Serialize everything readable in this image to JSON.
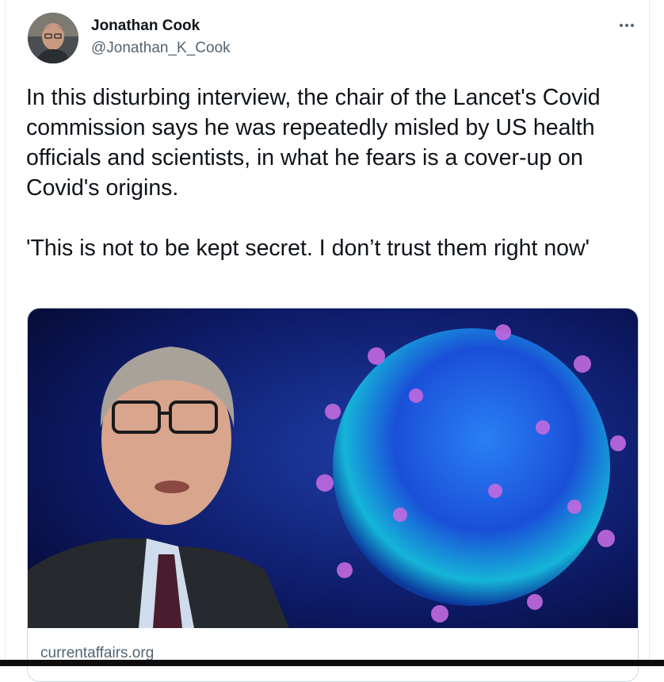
{
  "tweet": {
    "author": {
      "name": "Jonathan Cook",
      "handle": "@Jonathan_K_Cook",
      "avatar_icon": "person-avatar-icon"
    },
    "more_icon": "more-horizontal-icon",
    "text": "In this disturbing interview, the chair of the Lancet's Covid commission says he was repeatedly misled by US health officials and scientists, in what he fears is a cover-up on Covid's origins.\n\n'This is not to be kept secret. I don’t trust them right now'",
    "link_card": {
      "image_icon": "article-thumbnail-image",
      "domain": "currentaffairs.org"
    }
  },
  "colors": {
    "text_primary": "#0f1419",
    "text_secondary": "#536471",
    "border": "#cfd9de"
  }
}
